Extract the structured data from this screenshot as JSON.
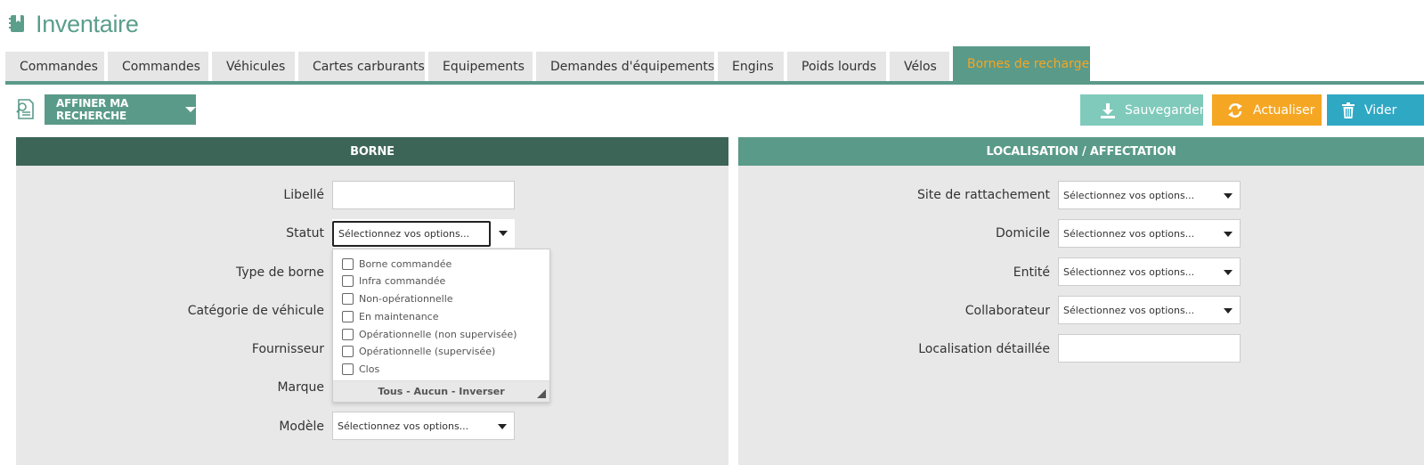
{
  "header": {
    "title": "Inventaire",
    "icon": "inventory-book-icon"
  },
  "tabs": [
    {
      "label": "Commandes"
    },
    {
      "label": "Commandes"
    },
    {
      "label": "Véhicules"
    },
    {
      "label": "Cartes carburants"
    },
    {
      "label": "Equipements"
    },
    {
      "label": "Demandes d'équipements"
    },
    {
      "label": "Engins"
    },
    {
      "label": "Poids lourds"
    },
    {
      "label": "Vélos"
    },
    {
      "label": "Bornes de recharge",
      "active": true
    }
  ],
  "toolbar": {
    "refine_label": "AFFINER MA RECHERCHE",
    "save_label": "Sauvegarder",
    "refresh_label": "Actualiser",
    "clear_label": "Vider"
  },
  "left_panel": {
    "title": "BORNE",
    "fields": {
      "libelle": {
        "label": "Libellé",
        "value": ""
      },
      "statut": {
        "label": "Statut",
        "placeholder": "Sélectionnez vos options..."
      },
      "type_borne": {
        "label": "Type de borne"
      },
      "categorie": {
        "label": "Catégorie de véhicule"
      },
      "fournisseur": {
        "label": "Fournisseur"
      },
      "marque": {
        "label": "Marque"
      },
      "modele": {
        "label": "Modèle",
        "placeholder": "Sélectionnez vos options..."
      }
    }
  },
  "statut_dropdown": {
    "options": [
      "Borne commandée",
      "Infra commandée",
      "Non-opérationnelle",
      "En maintenance",
      "Opérationnelle (non supervisée)",
      "Opérationnelle (supervisée)",
      "Clos"
    ],
    "footer": "Tous - Aucun - Inverser"
  },
  "right_panel": {
    "title": "LOCALISATION / AFFECTATION",
    "fields": {
      "site": {
        "label": "Site de rattachement",
        "placeholder": "Sélectionnez vos options..."
      },
      "domicile": {
        "label": "Domicile",
        "placeholder": "Sélectionnez vos options..."
      },
      "entite": {
        "label": "Entité",
        "placeholder": "Sélectionnez vos options..."
      },
      "collaborateur": {
        "label": "Collaborateur",
        "placeholder": "Sélectionnez vos options..."
      },
      "localisation": {
        "label": "Localisation détaillée",
        "value": ""
      }
    }
  },
  "colors": {
    "accent": "#5a9a89",
    "dark_header": "#3d6557",
    "active_tab_text": "#f5a623",
    "save": "#7fcabb",
    "refresh": "#f5a623",
    "clear": "#2fa8c4"
  }
}
